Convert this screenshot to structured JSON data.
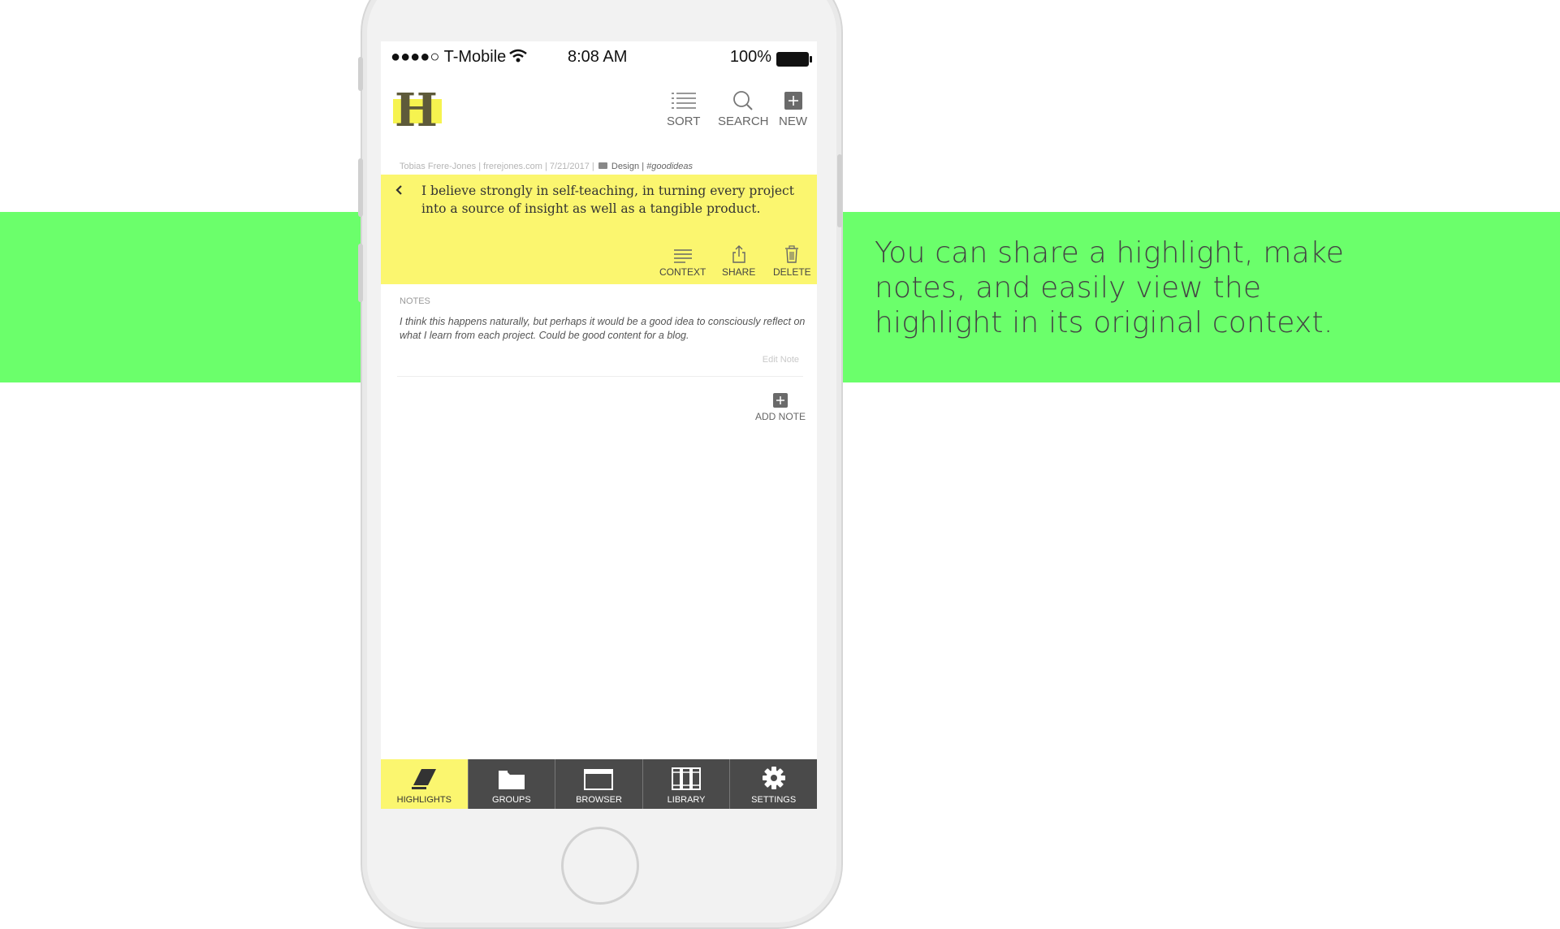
{
  "caption": "You can share a highlight, make notes, and easily view the highlight in its original context.",
  "status_bar": {
    "carrier": "●●●●○ T-Mobile",
    "time": "8:08 AM",
    "battery": "100%"
  },
  "app": {
    "logo_letter": "H",
    "toolbar": {
      "sort": "SORT",
      "search": "SEARCH",
      "new": "NEW"
    }
  },
  "highlight": {
    "author": "Tobias Frere-Jones",
    "site": "frerejones.com",
    "date": "7/21/2017",
    "group": "Design",
    "tag": "#goodideas",
    "quote": "I believe strongly in self-teaching, in turning every project into a source of insight as well as a tangible product.",
    "actions": {
      "context": "CONTEXT",
      "share": "SHARE",
      "delete": "DELETE"
    }
  },
  "notes": {
    "label": "NOTES",
    "text": "I think this happens naturally, but perhaps it would be a good idea to consciously reflect on what I learn from each project. Could be good content for a blog.",
    "edit_label": "Edit Note",
    "add_label": "ADD NOTE"
  },
  "tabbar": {
    "highlights": "HIGHLIGHTS",
    "groups": "GROUPS",
    "browser": "BROWSER",
    "library": "LIBRARY",
    "settings": "SETTINGS",
    "active": "highlights"
  },
  "colors": {
    "band": "#6bff6b",
    "highlight": "#fbf66f",
    "tabbar": "#4a4a4a"
  }
}
